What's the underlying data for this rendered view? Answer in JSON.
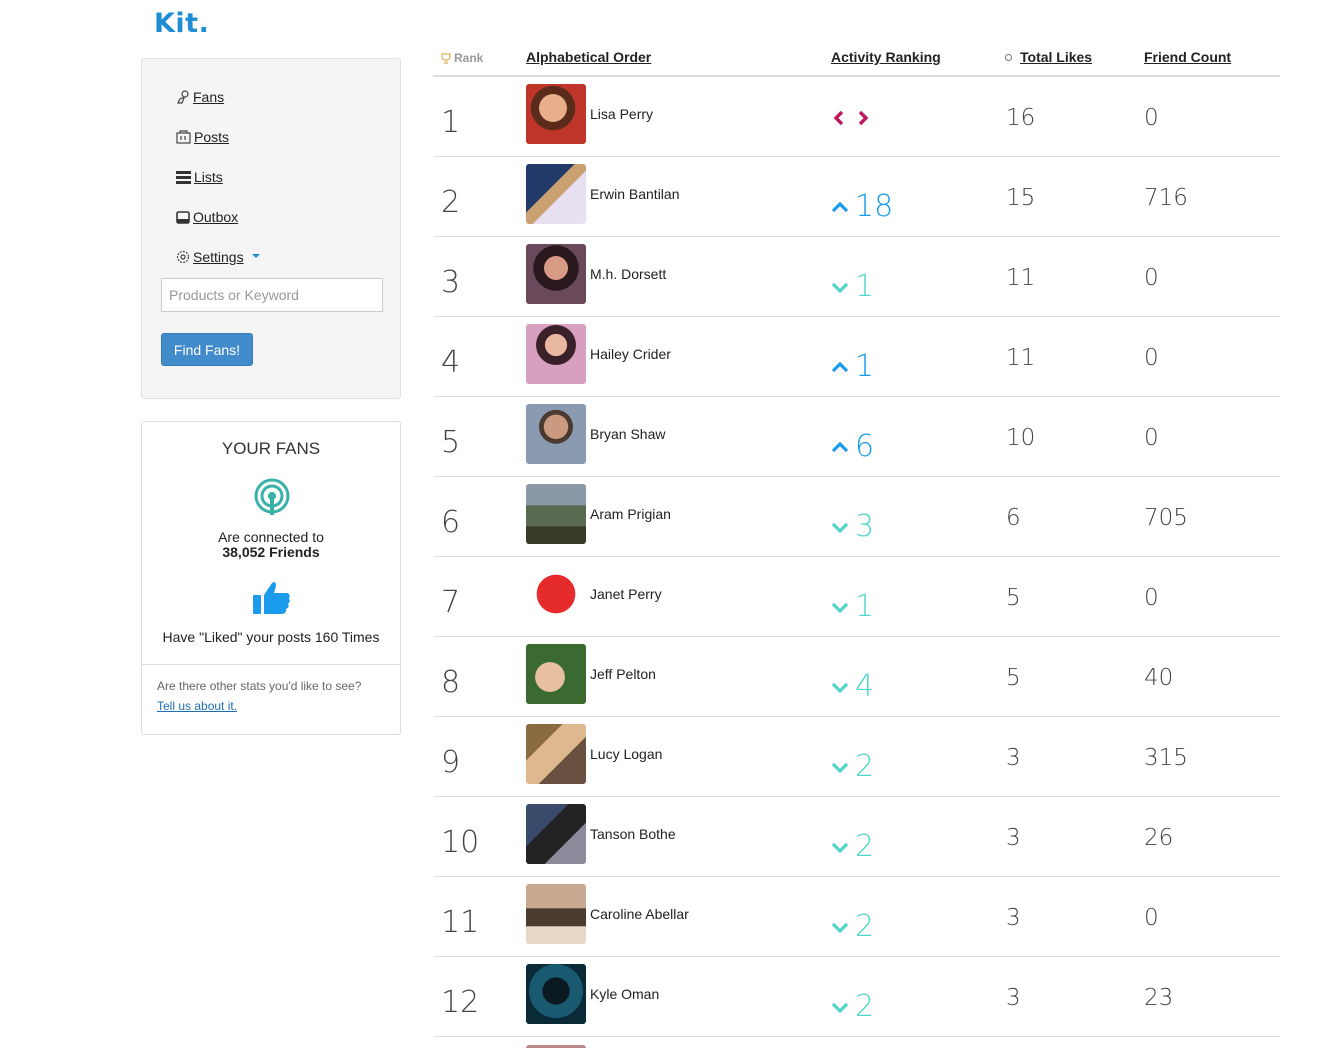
{
  "brand": {
    "logo": "Kit."
  },
  "nav": {
    "items": [
      {
        "label": "Fans",
        "icon": "fans-icon"
      },
      {
        "label": "Posts",
        "icon": "posts-icon"
      },
      {
        "label": "Lists",
        "icon": "lists-icon"
      },
      {
        "label": "Outbox",
        "icon": "outbox-icon"
      },
      {
        "label": "Settings",
        "icon": "gear-icon"
      }
    ],
    "search_placeholder": "Products or Keyword",
    "find_button": "Find Fans!"
  },
  "fans_panel": {
    "title": "YOUR FANS",
    "connected_line1": "Are connected to",
    "connected_line2": "38,052 Friends",
    "liked_text": "Have \"Liked\" your posts 160 Times",
    "other_stats": "Are there other stats you'd like to see?",
    "tell_link": "Tell us about it."
  },
  "colors": {
    "up": "#1a9bec",
    "down": "#4fd6c7",
    "neutral": "#c0185f",
    "brand": "#1f8dd6"
  },
  "table": {
    "headers": {
      "rank": "Rank",
      "alpha": "Alphabetical Order",
      "activity": "Activity Ranking",
      "likes": "Total Likes",
      "friends": "Friend Count"
    },
    "rows": [
      {
        "rank": "1",
        "name": "Lisa Perry",
        "trend": "neutral",
        "change": "",
        "likes": "16",
        "friends": "0",
        "avatar": "avatar-red"
      },
      {
        "rank": "2",
        "name": "Erwin Bantilan",
        "trend": "up",
        "change": "18",
        "likes": "15",
        "friends": "716",
        "avatar": "avatar-blue"
      },
      {
        "rank": "3",
        "name": "M.h. Dorsett",
        "trend": "down",
        "change": "1",
        "likes": "11",
        "friends": "0",
        "avatar": "avatar-purple"
      },
      {
        "rank": "4",
        "name": "Hailey Crider",
        "trend": "up",
        "change": "1",
        "likes": "11",
        "friends": "0",
        "avatar": "avatar-rose"
      },
      {
        "rank": "5",
        "name": "Bryan Shaw",
        "trend": "up",
        "change": "6",
        "likes": "10",
        "friends": "0",
        "avatar": "avatar-grey"
      },
      {
        "rank": "6",
        "name": "Aram Prigian",
        "trend": "down",
        "change": "3",
        "likes": "6",
        "friends": "705",
        "avatar": "avatar-landscape"
      },
      {
        "rank": "7",
        "name": "Janet Perry",
        "trend": "down",
        "change": "1",
        "likes": "5",
        "friends": "0",
        "avatar": "avatar-heart"
      },
      {
        "rank": "8",
        "name": "Jeff Pelton",
        "trend": "down",
        "change": "4",
        "likes": "5",
        "friends": "40",
        "avatar": "avatar-green"
      },
      {
        "rank": "9",
        "name": "Lucy Logan",
        "trend": "down",
        "change": "2",
        "likes": "3",
        "friends": "315",
        "avatar": "avatar-warm"
      },
      {
        "rank": "10",
        "name": "Tanson Bothe",
        "trend": "down",
        "change": "2",
        "likes": "3",
        "friends": "26",
        "avatar": "avatar-dark"
      },
      {
        "rank": "11",
        "name": "Caroline Abellar",
        "trend": "down",
        "change": "2",
        "likes": "3",
        "friends": "0",
        "avatar": "avatar-tan"
      },
      {
        "rank": "12",
        "name": "Kyle Oman",
        "trend": "down",
        "change": "2",
        "likes": "3",
        "friends": "23",
        "avatar": "avatar-teal"
      }
    ]
  }
}
